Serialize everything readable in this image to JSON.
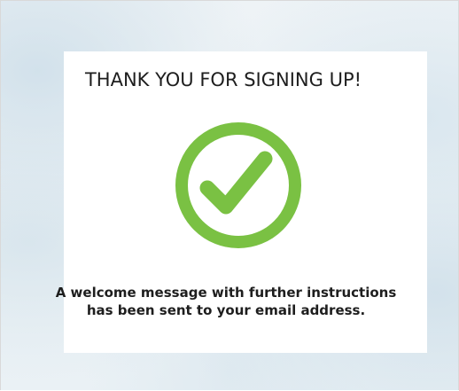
{
  "confirmation": {
    "title": "THANK YOU FOR SIGNING UP!",
    "icon": "checkmark-circle-icon",
    "accent_color": "#7ac143",
    "message_line1": "A welcome message with further instructions",
    "message_line2": "has been sent to your email address."
  }
}
